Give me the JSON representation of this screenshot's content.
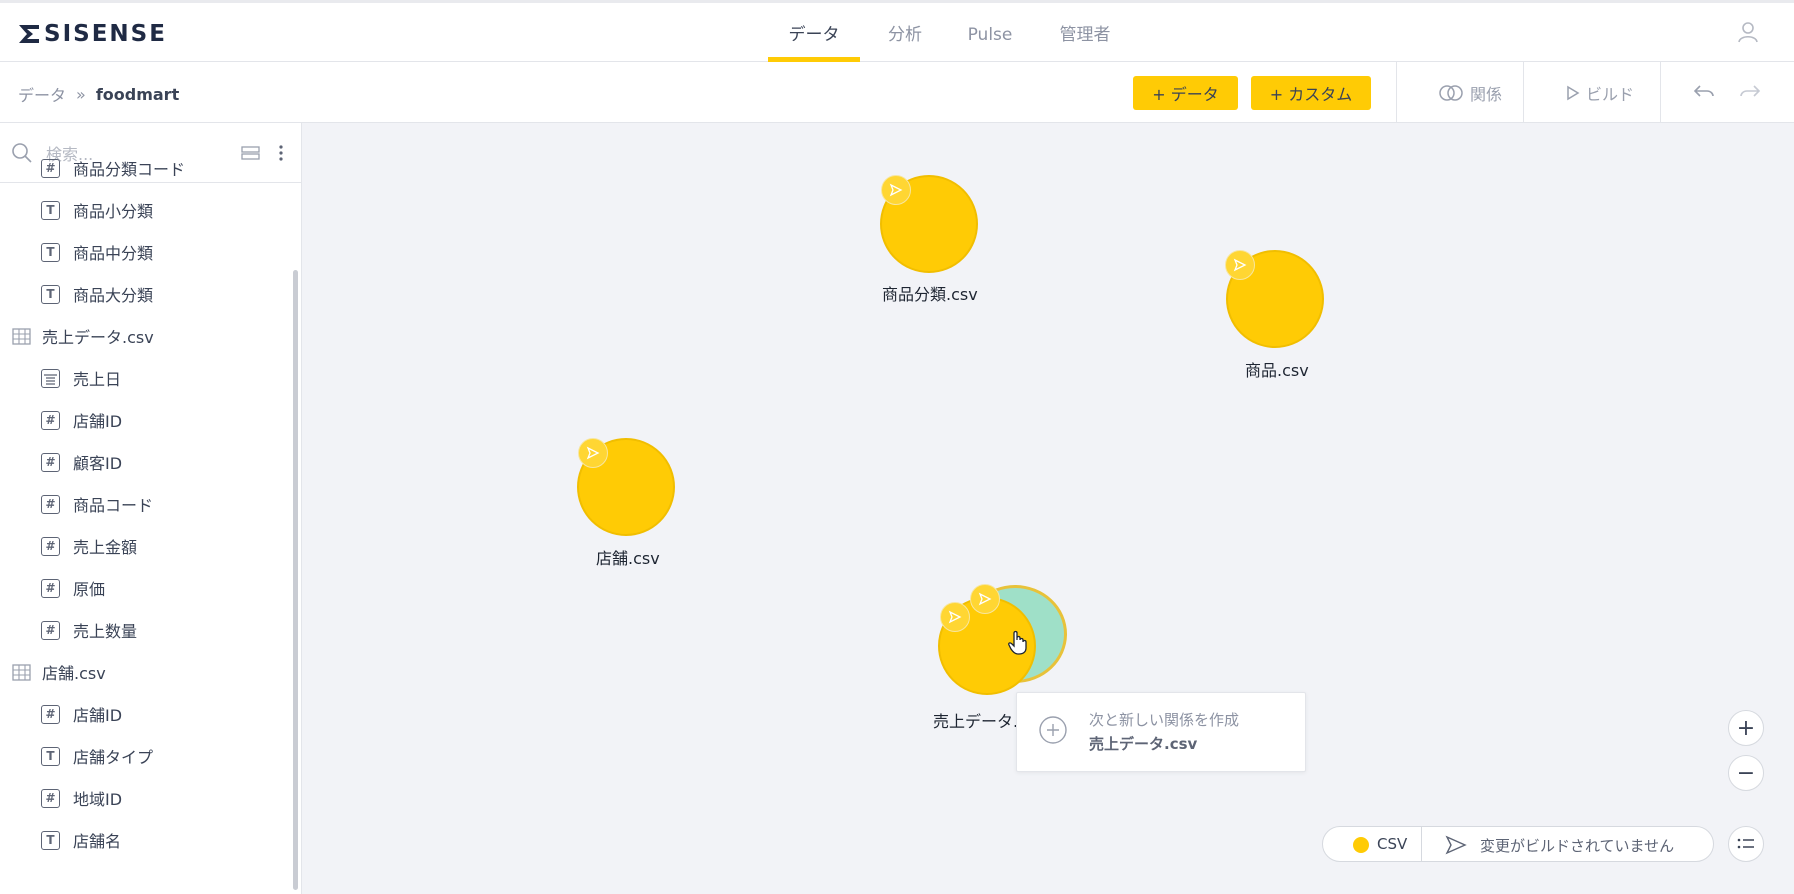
{
  "app": {
    "logo_text": "SISENSE"
  },
  "nav": {
    "tabs": [
      {
        "label": "データ",
        "active": true
      },
      {
        "label": "分析",
        "active": false
      },
      {
        "label": "Pulse",
        "active": false
      },
      {
        "label": "管理者",
        "active": false
      }
    ]
  },
  "breadcrumb": {
    "root": "データ",
    "separator": "»",
    "current": "foodmart"
  },
  "toolbar": {
    "add_data_label": "+ データ",
    "add_custom_label": "+ カスタム",
    "relations_label": "関係",
    "build_label": "ビルド"
  },
  "sidebar": {
    "search_placeholder": "検索...",
    "items": [
      {
        "kind": "number",
        "icon": "#",
        "label": "商品分類コード"
      },
      {
        "kind": "text",
        "icon": "T",
        "label": "商品小分類"
      },
      {
        "kind": "text",
        "icon": "T",
        "label": "商品中分類"
      },
      {
        "kind": "text",
        "icon": "T",
        "label": "商品大分類"
      },
      {
        "kind": "table",
        "icon": "table-icon",
        "label": "売上データ.csv"
      },
      {
        "kind": "date",
        "icon": "calendar-icon",
        "label": "売上日"
      },
      {
        "kind": "number",
        "icon": "#",
        "label": "店舗ID"
      },
      {
        "kind": "number",
        "icon": "#",
        "label": "顧客ID"
      },
      {
        "kind": "number",
        "icon": "#",
        "label": "商品コード"
      },
      {
        "kind": "number",
        "icon": "#",
        "label": "売上金額"
      },
      {
        "kind": "number",
        "icon": "#",
        "label": "原価"
      },
      {
        "kind": "number",
        "icon": "#",
        "label": "売上数量"
      },
      {
        "kind": "table",
        "icon": "table-icon",
        "label": "店舗.csv"
      },
      {
        "kind": "number",
        "icon": "#",
        "label": "店舗ID"
      },
      {
        "kind": "text",
        "icon": "T",
        "label": "店舗タイプ"
      },
      {
        "kind": "number",
        "icon": "#",
        "label": "地域ID"
      },
      {
        "kind": "text",
        "icon": "T",
        "label": "店舗名"
      }
    ]
  },
  "canvas": {
    "nodes": [
      {
        "label": "商品分類.csv"
      },
      {
        "label": "商品.csv"
      },
      {
        "label": "店舗.csv"
      },
      {
        "label": "売上データ.csv"
      }
    ],
    "popup": {
      "line1": "次と新しい関係を作成",
      "line2": "売上データ.csv"
    },
    "zoom_in": "+",
    "zoom_out": "−",
    "legend": {
      "csv_label": "CSV",
      "build_status": "変更がビルドされていません"
    }
  },
  "colors": {
    "accent": "#ffcb05",
    "node_highlight": "#9fe0c8"
  }
}
